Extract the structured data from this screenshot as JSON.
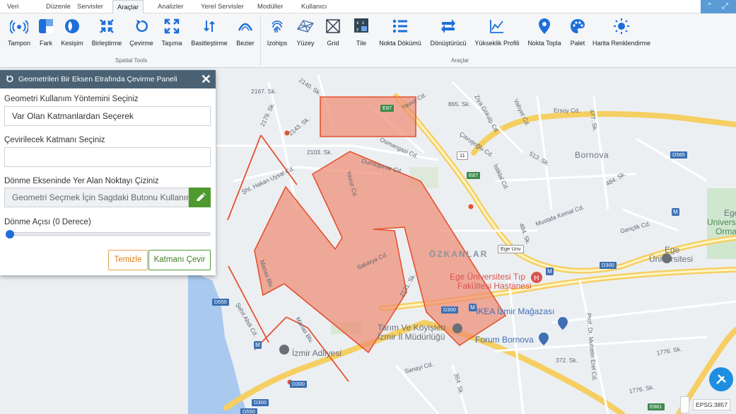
{
  "menu": {
    "items": [
      {
        "label": "Veri"
      },
      {
        "label": "Düzenle"
      },
      {
        "label": "Servisler"
      },
      {
        "label": "Araçlar"
      },
      {
        "label": "Analizler"
      },
      {
        "label": "Yerel Servisler"
      },
      {
        "label": "Modüller"
      },
      {
        "label": "Kullanıcı"
      }
    ],
    "active": "Araçlar"
  },
  "ribbon": {
    "spatial_tools": {
      "group_label": "Spatial Tools",
      "tools": [
        {
          "label": "Tampon",
          "icon": "buffer-icon"
        },
        {
          "label": "Fark",
          "icon": "difference-icon"
        },
        {
          "label": "Kesişim",
          "icon": "intersection-icon"
        },
        {
          "label": "Birleştirme",
          "icon": "merge-icon"
        },
        {
          "label": "Çevirme",
          "icon": "rotate-icon"
        },
        {
          "label": "Taşıma",
          "icon": "move-icon"
        },
        {
          "label": "Basitleştirme",
          "icon": "simplify-icon"
        },
        {
          "label": "Bezier",
          "icon": "bezier-icon"
        }
      ]
    },
    "tools": {
      "group_label": "Araçlar",
      "tools": [
        {
          "label": "Izohips",
          "icon": "fingerprint-icon"
        },
        {
          "label": "Yüzey",
          "icon": "surface-icon"
        },
        {
          "label": "Grid",
          "icon": "grid-icon"
        },
        {
          "label": "Tile",
          "icon": "tile-icon"
        },
        {
          "label": "Nokta Dökümü",
          "icon": "list-icon"
        },
        {
          "label": "Dönüştürücü",
          "icon": "convert-icon"
        },
        {
          "label": "Yükseklik Profili",
          "icon": "profile-chart-icon"
        },
        {
          "label": "Nokta Topla",
          "icon": "map-pin-icon"
        },
        {
          "label": "Palet",
          "icon": "palette-icon"
        },
        {
          "label": "Harita Renklendirme",
          "icon": "sun-icon"
        }
      ]
    }
  },
  "panel": {
    "title": "Geometrileri Bir Eksen Etrafında Çevirme Paneli",
    "method_label": "Geometri Kullanım Yöntemini Seçiniz",
    "method_value": "Var Olan Katmanlardan Seçerek",
    "layer_label": "Çevirilecek Katmanı Seçiniz",
    "layer_value": "",
    "axis_label": "Dönme Ekseninde Yer Alan Noktayı Çiziniz",
    "axis_placeholder": "Geometri Seçmek İçin Sagdaki Butonu Kullanın",
    "angle_label": "Dönme Açısı (0 Derece)",
    "angle_value": 0,
    "clear_button": "Temizle",
    "rotate_button": "Katmanı Çevir"
  },
  "map": {
    "labels": {
      "bornova": "Bornova",
      "ozkanlar": "ÖZKANLAR",
      "ege_tip": "Ege Üniversitesi Tıp",
      "ege_tip2": "Fakültesi Hastanesi",
      "ikea": "IKEA İzmir Mağazası",
      "forum": "Forum Bornova",
      "tarim": "Tarım Ve Köyişleri",
      "tarim2": "İzmir İl Müdürlüğü",
      "adliye": "İzmir Adliyesi",
      "ege_univ": "Ege",
      "ege_univ2": "Üniversitesi",
      "ege_right": "Ege",
      "ege_right2": "Universi",
      "ege_right3": "Orma",
      "s2140": "2140. Sk.",
      "s2167": "2167. Sk.",
      "s2179": "2179. Sk.",
      "s2143": "2143. Sk.",
      "s2103": "2103. Sk.",
      "hakan": "Şht. Hakan Uysal Cd.",
      "yavuz": "Yavuz Cd.",
      "yavuz2": "Yavuz Cd.",
      "osmangazi": "Osmangazi Cd.",
      "dumlupinar": "Dumlupınar Cd.",
      "s865": "865. Sk.",
      "zuhal": "Ziya Gökalp Cd.",
      "cavusoglu": "Çavuşoğlu Cd.",
      "vahyet": "Vahyet Cd.",
      "ersoy": "Ersoy Cd.",
      "s477": "477. Sk.",
      "s513": "513. Sk.",
      "istiklal": "İstiklal Cd.",
      "s484": "484. Sk.",
      "mustafa": "Mustafa Kemal Cd.",
      "genclik": "Gençlik Cd.",
      "ege_unv": "Ege Unv",
      "sakarya": "Sakarya Cd.",
      "s2131": "2131. Sk.",
      "manas": "Manas Blv.",
      "manas2": "Manas Blv.",
      "abdi": "Şehit Abdi Cd.",
      "sanayi": "Sanayi Cd.",
      "s364": "364. Sk.",
      "s372": "372. Sk.",
      "s1776": "1776. Sk.",
      "s1776b": "1776. Sk.",
      "muhittin": "Prof. Dr. Muhittin Erel Cd.",
      "e87": "E87",
      "e87b": "E87",
      "d565": "D565",
      "d300a": "D300",
      "d300b": "D300",
      "d300c": "D300",
      "d300d": "D300",
      "d550": "D550",
      "d550b": "D550",
      "e881": "E881",
      "n11": "11",
      "metro": "M"
    },
    "epsg": "EPSG:3857"
  },
  "colors": {
    "panel_header": "#4a6274",
    "polygon_fill": "#f08a72",
    "polygon_stroke": "#e5522f",
    "accent_green": "#4f9a2f",
    "accent_orange": "#e07b14",
    "fab": "#1e8fe0"
  }
}
